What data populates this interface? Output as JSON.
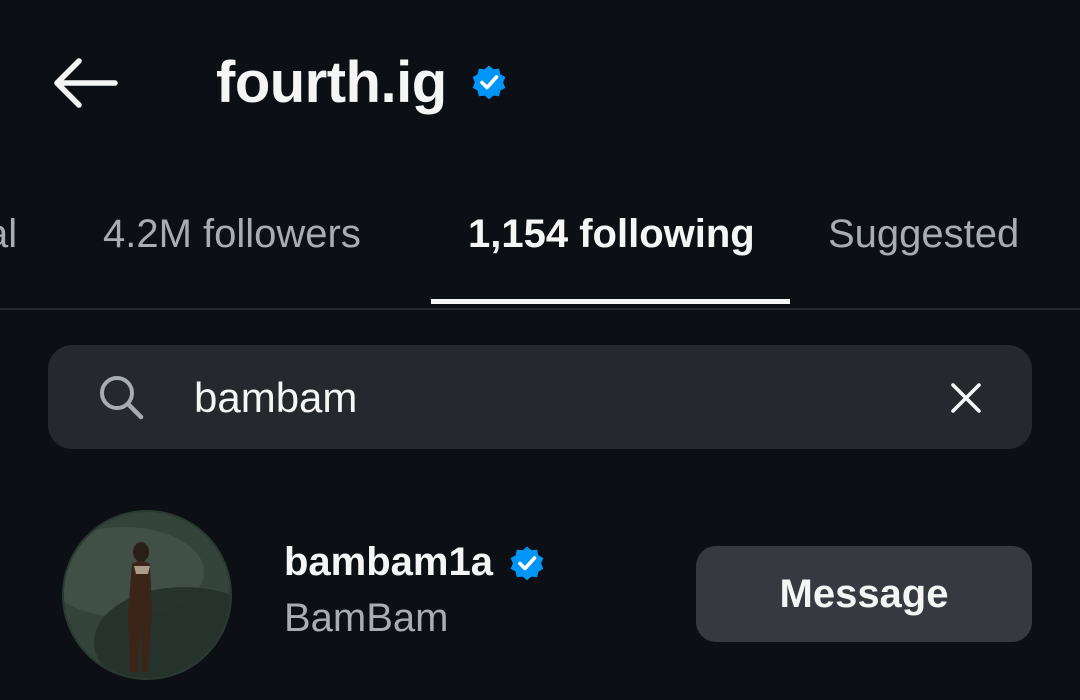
{
  "header": {
    "title": "fourth.ig",
    "back_icon": "arrow-left-icon",
    "verified_icon": "verified-badge-icon"
  },
  "tabs": [
    {
      "label": "Mutual",
      "visible_text": "al",
      "active": false
    },
    {
      "label": "4.2M followers",
      "active": false
    },
    {
      "label": "1,154 following",
      "active": true
    },
    {
      "label": "Suggested",
      "active": false
    }
  ],
  "search": {
    "value": "bambam",
    "icon": "search-icon",
    "clear_icon": "close-icon"
  },
  "results": [
    {
      "username": "bambam1a",
      "full_name": "BamBam",
      "verified": true,
      "action_label": "Message"
    }
  ],
  "colors": {
    "background": "#0c1014",
    "text_primary": "#f5f5f5",
    "text_secondary": "#a8adb3",
    "verified_blue": "#0095f6",
    "search_bg": "#25292e",
    "button_bg": "#363a40"
  }
}
